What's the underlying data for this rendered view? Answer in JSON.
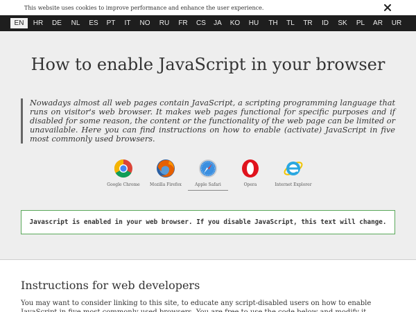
{
  "cookie": {
    "text": "This website uses cookies to improve performance and enhance the user experience."
  },
  "languages": [
    "EN",
    "HR",
    "DE",
    "NL",
    "ES",
    "PT",
    "IT",
    "NO",
    "RU",
    "FR",
    "CS",
    "JA",
    "KO",
    "HU",
    "TH",
    "TL",
    "TR",
    "ID",
    "SK",
    "PL",
    "AR",
    "UR"
  ],
  "active_language": "EN",
  "page": {
    "title": "How to enable JavaScript in your browser",
    "intro": "Nowadays almost all web pages contain JavaScript, a scripting programming language that runs on visitor's web browser. It makes web pages functional for specific purposes and if disabled for some reason, the content or the functionality of the web page can be limited or unavailable. Here you can find instructions on how to enable (activate) JavaScript in five most commonly used browsers."
  },
  "browsers": [
    {
      "label": "Google Chrome",
      "icon": "chrome-icon"
    },
    {
      "label": "Mozilla Firefox",
      "icon": "firefox-icon"
    },
    {
      "label": "Apple Safari",
      "icon": "safari-icon",
      "selected": true
    },
    {
      "label": "Opera",
      "icon": "opera-icon"
    },
    {
      "label": "Internet Explorer",
      "icon": "internet-explorer-icon"
    }
  ],
  "js_status": {
    "text": "Javascript is enabled in your web browser. If you disable JavaScript, this text will change."
  },
  "developers": {
    "heading": "Instructions for web developers",
    "text": "You may want to consider linking to this site, to educate any script-disabled users on how to enable JavaScript in five most commonly used browsers. You are free to use the code below and modify it according to your needs."
  },
  "colors": {
    "lang_bar": "#1e1e1e",
    "main_bg": "#eeeeee",
    "js_box_border": "#5aa85a"
  }
}
